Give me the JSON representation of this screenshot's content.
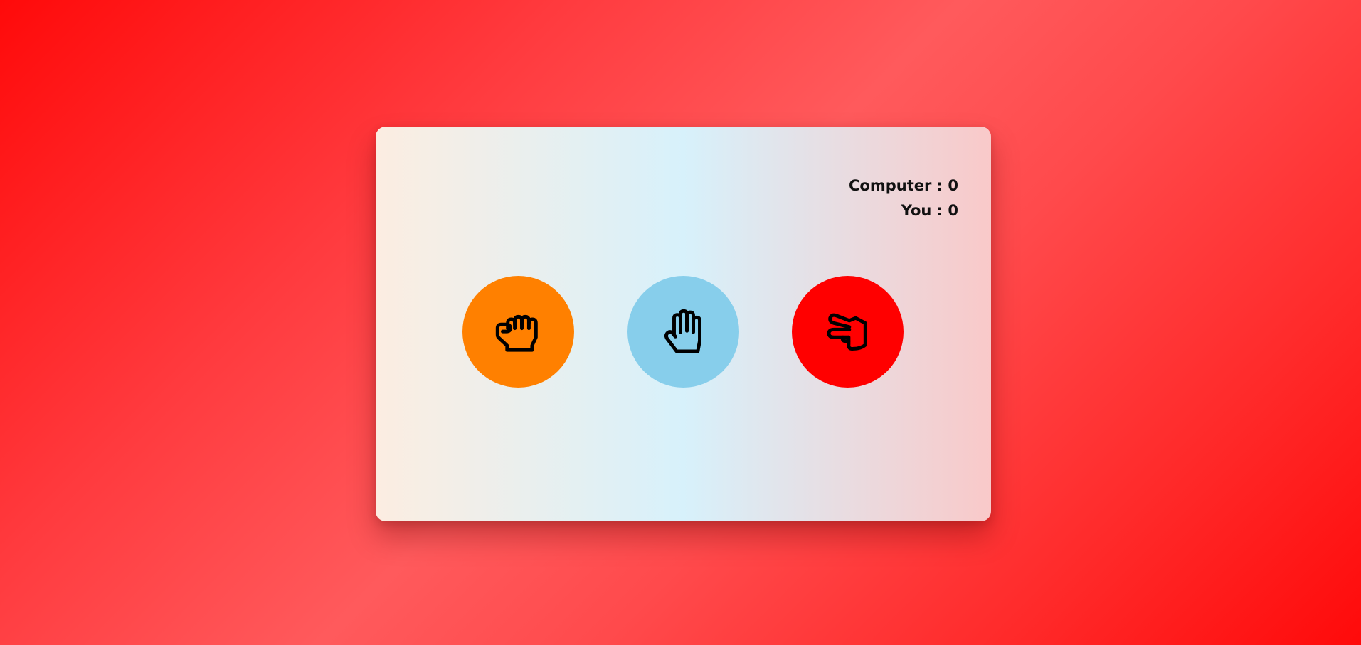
{
  "game": {
    "scoreboard": {
      "computer_label": "Computer",
      "computer_score": "0",
      "you_label": "You",
      "you_score": "0",
      "separator": " : "
    },
    "choices": [
      {
        "name": "rock",
        "icon": "hand-fist-icon",
        "color": "#ff8000"
      },
      {
        "name": "paper",
        "icon": "hand-open-icon",
        "color": "#87ceeb"
      },
      {
        "name": "scissors",
        "icon": "hand-scissors-icon",
        "color": "#ff0000"
      }
    ]
  },
  "colors": {
    "background": "#ff3a3e",
    "card_left": "#fcede1",
    "card_middle": "#d7f1fb",
    "card_right": "#f9c9c9",
    "text": "#111111"
  }
}
